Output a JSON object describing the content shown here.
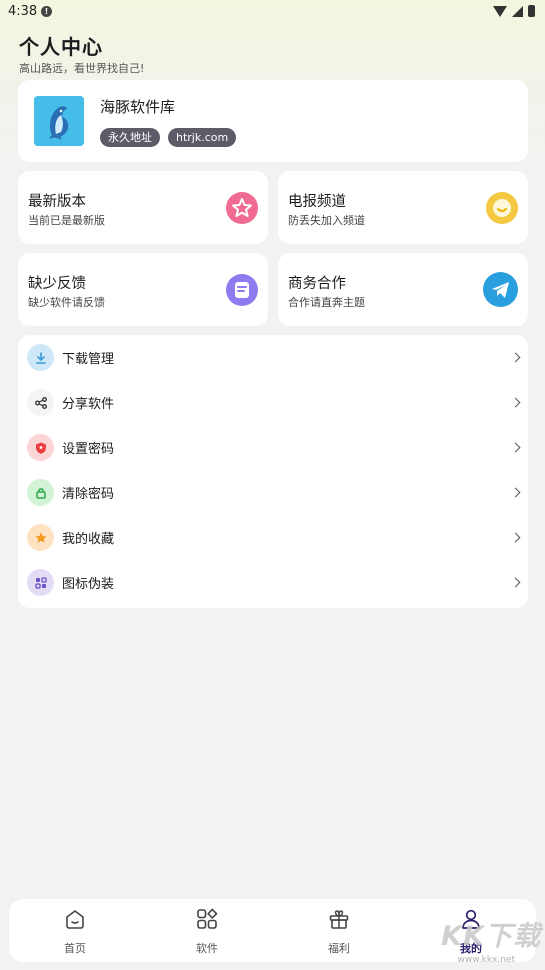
{
  "status_bar": {
    "time": "4:38",
    "alert": "!"
  },
  "header": {
    "title": "个人中心",
    "subtitle": "高山路远，看世界找自己!"
  },
  "profile": {
    "name": "海豚软件库",
    "tags": [
      "永久地址",
      "htrjk.com"
    ]
  },
  "grid": [
    {
      "title": "最新版本",
      "subtitle": "当前已是最新版",
      "icon": "star-badge-icon",
      "color": "#f06a92"
    },
    {
      "title": "电报频道",
      "subtitle": "防丢失加入频道",
      "icon": "smile-chat-icon",
      "color": "#f5c842"
    },
    {
      "title": "缺少反馈",
      "subtitle": "缺少软件请反馈",
      "icon": "feedback-note-icon",
      "color": "#8e7bf0"
    },
    {
      "title": "商务合作",
      "subtitle": "合作请直奔主题",
      "icon": "telegram-icon",
      "color": "#2a9fe0"
    }
  ],
  "menu": [
    {
      "label": "下载管理",
      "icon": "download-icon",
      "color": "#cfe8f8"
    },
    {
      "label": "分享软件",
      "icon": "share-icon",
      "color": "#f4f4f4"
    },
    {
      "label": "设置密码",
      "icon": "shield-icon",
      "color": "#fcd6d6"
    },
    {
      "label": "清除密码",
      "icon": "lock-icon",
      "color": "#d2f3d6"
    },
    {
      "label": "我的收藏",
      "icon": "star-icon",
      "color": "#fde3c2"
    },
    {
      "label": "图标伪装",
      "icon": "apps-icon",
      "color": "#e3dcf4"
    }
  ],
  "bottom_nav": [
    {
      "label": "首页",
      "icon": "home-icon"
    },
    {
      "label": "软件",
      "icon": "software-icon"
    },
    {
      "label": "福利",
      "icon": "gift-icon"
    },
    {
      "label": "我的",
      "icon": "profile-icon",
      "active": true
    }
  ],
  "watermark": {
    "text": "KK下载",
    "url": "www.kkx.net"
  }
}
